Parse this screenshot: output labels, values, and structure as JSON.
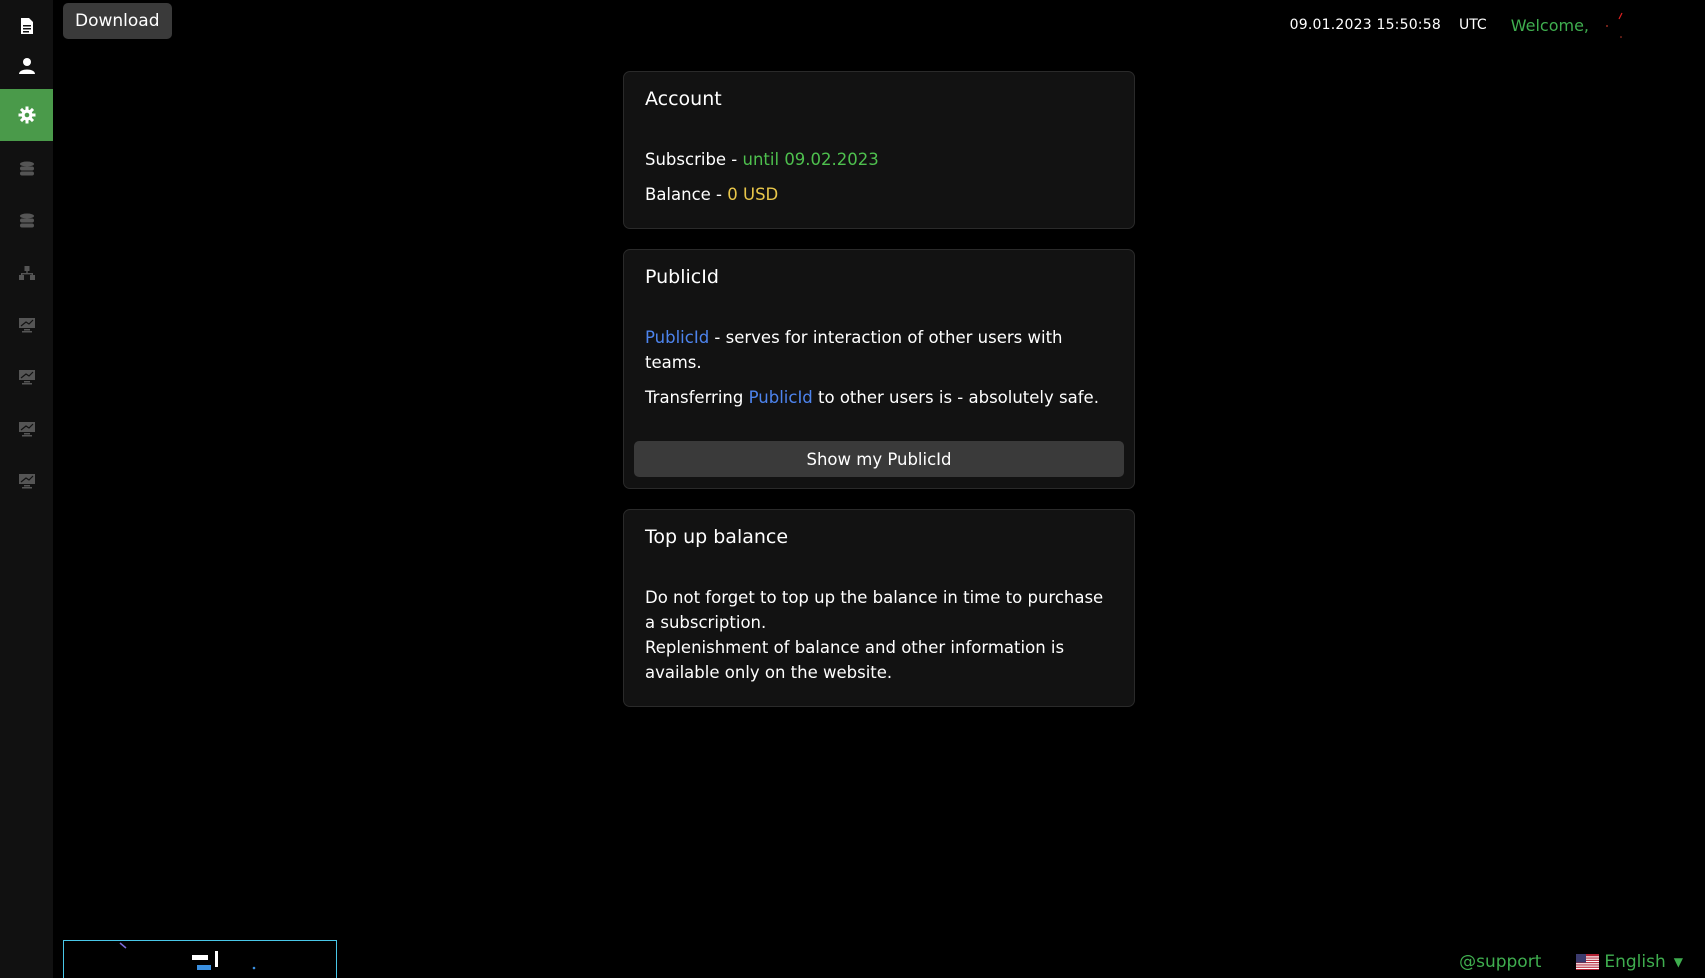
{
  "toolbar": {
    "download_label": "Download"
  },
  "sidebar": {
    "items": [
      {
        "icon": "document-icon",
        "active": false
      },
      {
        "icon": "user-icon",
        "active": false
      },
      {
        "icon": "gear-icon",
        "active": true
      },
      {
        "icon": "database-icon",
        "active": false
      },
      {
        "icon": "database-icon",
        "active": false
      },
      {
        "icon": "network-icon",
        "active": false
      },
      {
        "icon": "monitor-icon",
        "active": false
      },
      {
        "icon": "monitor-icon",
        "active": false
      },
      {
        "icon": "monitor-icon",
        "active": false
      },
      {
        "icon": "monitor-icon",
        "active": false
      }
    ]
  },
  "header": {
    "datetime": "09.01.2023 15:50:58",
    "timezone": "UTC",
    "welcome": "Welcome,"
  },
  "account": {
    "title": "Account",
    "subscribe_label": "Subscribe - ",
    "subscribe_value": "until 09.02.2023",
    "balance_label": "Balance - ",
    "balance_value": "0 USD"
  },
  "publicid": {
    "title": "PublicId",
    "link_text": "PublicId",
    "desc_rest": " - serves for interaction of other users with teams.",
    "transfer_pre": "Transferring ",
    "transfer_link": "PublicId",
    "transfer_post": " to other users is - absolutely safe.",
    "button_label": "Show my PublicId"
  },
  "topup": {
    "title": "Top up balance",
    "line1": "Do not forget to top up the balance in time to purchase a subscription.",
    "line2": "Replenishment of balance and other information is available only on the website."
  },
  "footer": {
    "support": "@support",
    "language": "English"
  },
  "colors": {
    "accent_green": "#4a9a4a",
    "text_green": "#4ec04e",
    "gold": "#e8c64a",
    "link_blue": "#4d84ee"
  }
}
